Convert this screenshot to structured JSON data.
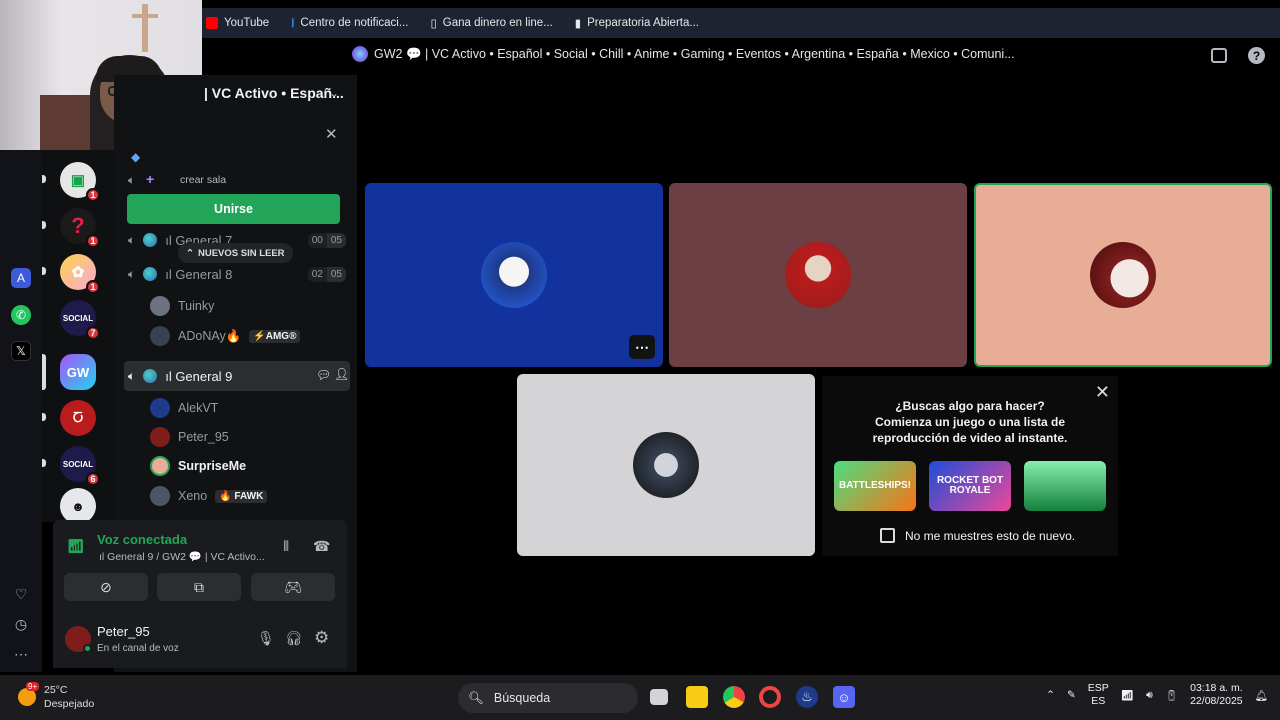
{
  "bookmarks": [
    {
      "label": "YouTube",
      "icon": "youtube-icon",
      "color": "#ff0000"
    },
    {
      "label": "Centro de notificaci...",
      "icon": "info-icon",
      "color": "#3b82f6"
    },
    {
      "label": "Gana dinero en line...",
      "icon": "page-icon",
      "color": "#d1d5db"
    },
    {
      "label": "Preparatoria Abierta...",
      "icon": "flag-icon",
      "color": "#d1d5db"
    }
  ],
  "channel_bar": {
    "title": "GW2 💬 | VC Activo • Español • Social • Chill • Anime • Gaming • Eventos • Argentina • España • Mexico • Comuni..."
  },
  "server": {
    "title": "| VC Activo • Españ..."
  },
  "sidebar": {
    "create_room": "crear sala",
    "join_button": "Unirse",
    "unread_pill": "NUEVOS SIN LEER",
    "channels": [
      {
        "name": "ıl General 7",
        "count_a": "00",
        "count_b": "05"
      },
      {
        "name": "ıl General 8",
        "count_a": "02",
        "count_b": "05"
      },
      {
        "name": "ıl General 9"
      }
    ],
    "users_general8": [
      {
        "name": "Tuinky",
        "tag": ""
      },
      {
        "name": "ADoNAy🔥",
        "tag": "⚡AMG®"
      }
    ],
    "users_general9": [
      {
        "name": "AlekVT",
        "tag": ""
      },
      {
        "name": "Peter_95",
        "tag": ""
      },
      {
        "name": "SurpriseMe",
        "tag": ""
      },
      {
        "name": "Xeno",
        "tag": "🔥 FAWK"
      }
    ]
  },
  "servers": [
    {
      "badge": "1"
    },
    {
      "badge": "1"
    },
    {
      "badge": "1"
    },
    {
      "badge": "7"
    },
    {
      "badge": ""
    },
    {
      "badge": ""
    },
    {
      "badge": "6"
    },
    {
      "badge": ""
    }
  ],
  "voice": {
    "title": "Voz conectada",
    "subtitle": "ıl General 9 / GW2 💬 | VC Activo..."
  },
  "user_panel": {
    "name": "Peter_95",
    "status": "En el canal de voz"
  },
  "activity": {
    "title": "¿Buscas algo para hacer?",
    "subtitle": "Comienza un juego o una lista de reproducción de video al instante.",
    "games": [
      "BATTLESHIPS!",
      "ROCKET BOT ROYALE",
      ""
    ],
    "checkbox": "No me muestres esto de nuevo."
  },
  "taskbar": {
    "temp": "25°C",
    "weather": "Despejado",
    "weather_badge": "9+",
    "search": "Búsqueda",
    "lang_top": "ESP",
    "lang_bottom": "ES",
    "time": "03:18 a. m.",
    "date": "22/08/2025"
  },
  "colors": {
    "accent_green": "#23a559",
    "tile_blue": "#12339e",
    "tile_brown": "#6b3f43",
    "tile_peach": "#e8ad97"
  }
}
